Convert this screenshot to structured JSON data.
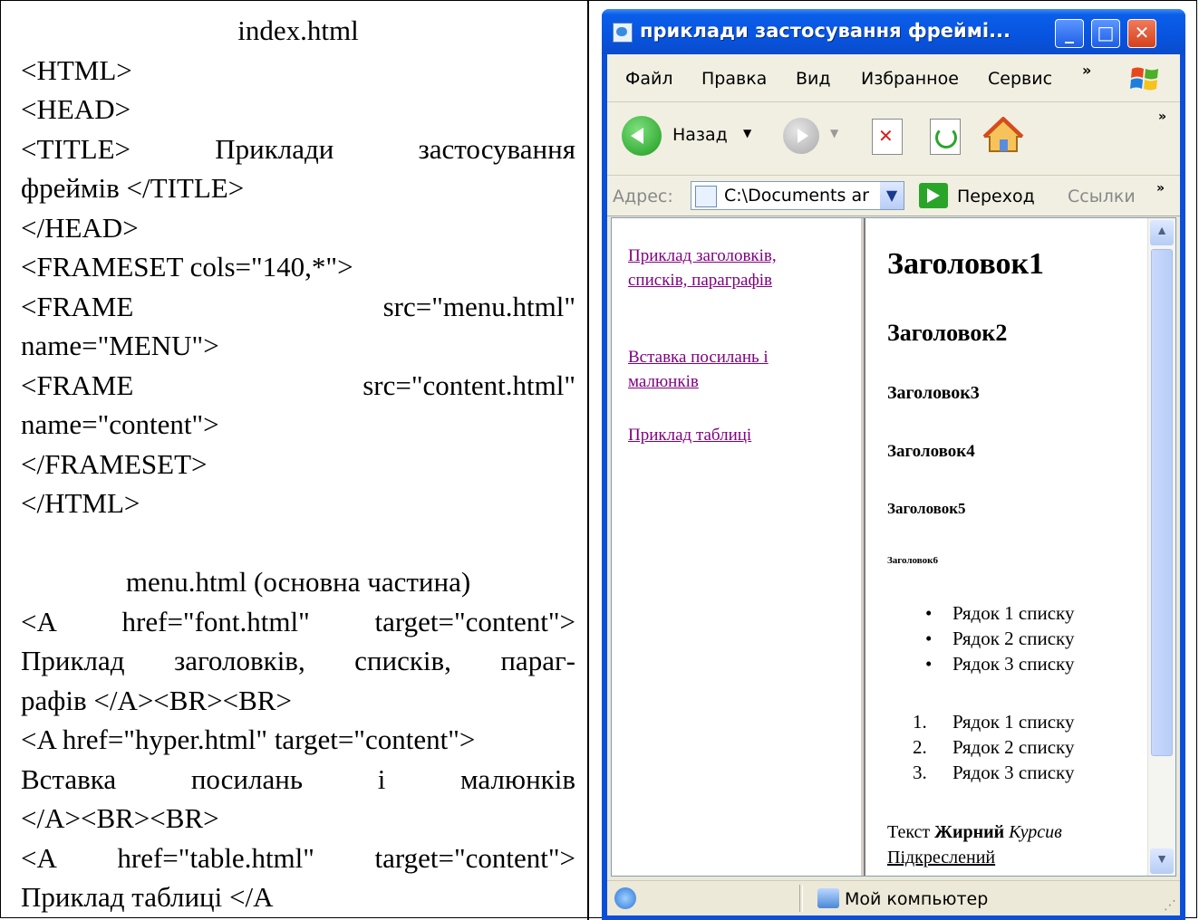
{
  "code_panel": {
    "index_title": "index.html",
    "index_lines": [
      {
        "type": "plain",
        "text": "<HTML>"
      },
      {
        "type": "plain",
        "text": "<HEAD>"
      },
      {
        "type": "just",
        "parts": [
          "<TITLE>",
          "Приклади",
          "застосування"
        ]
      },
      {
        "type": "plain",
        "text": "фреймів </TITLE>"
      },
      {
        "type": "plain",
        "text": "</HEAD>"
      },
      {
        "type": "plain",
        "text": "<FRAMESET cols=\"140,*\">"
      },
      {
        "type": "just",
        "parts": [
          "<FRAME",
          "src=\"menu.html\""
        ]
      },
      {
        "type": "plain",
        "text": "name=\"MENU\">"
      },
      {
        "type": "just",
        "parts": [
          "<FRAME",
          "src=\"content.html\""
        ]
      },
      {
        "type": "plain",
        "text": "name=\"content\">"
      },
      {
        "type": "plain",
        "text": "</FRAMESET>"
      },
      {
        "type": "plain",
        "text": "</HTML>"
      }
    ],
    "menu_title": "menu.html (основна частина)",
    "menu_lines": [
      {
        "type": "just",
        "parts": [
          "<A",
          "href=\"font.html\"",
          "target=\"content\">"
        ]
      },
      {
        "type": "just",
        "parts": [
          "Приклад",
          "заголовків,",
          "списків,",
          "параг-"
        ]
      },
      {
        "type": "plain",
        "text": "рафів </A><BR><BR>"
      },
      {
        "type": "plain",
        "text": "<A href=\"hyper.html\" target=\"content\">"
      },
      {
        "type": "just",
        "parts": [
          "Вставка",
          "посилань",
          "і",
          "малюнків"
        ]
      },
      {
        "type": "plain",
        "text": "</A><BR><BR>"
      },
      {
        "type": "just",
        "parts": [
          "<A",
          "href=\"table.html\"",
          "target=\"content\">"
        ]
      },
      {
        "type": "plain",
        "text": "Приклад таблиці </A"
      }
    ]
  },
  "window": {
    "title": "приклади застосування фреймі...",
    "minimize_label": "_",
    "maximize_label": "□",
    "close_label": "✕",
    "menu": [
      "Файл",
      "Правка",
      "Вид",
      "Избранное",
      "Сервис"
    ],
    "menu_more": "»",
    "toolbar": {
      "back_label": "Назад",
      "back_drop": "▼",
      "fwd_drop": "▼",
      "more": "»"
    },
    "address": {
      "label": "Адрес:",
      "value": "C:\\Documents ar",
      "dropdown": "▼",
      "go_label": "Переход",
      "links_label": "Ссылки",
      "more": "»"
    },
    "left_frame_links": [
      "Приклад заголовків, списків, параграфів",
      "Вставка посилань і малюнків",
      "Приклад таблиці"
    ],
    "content": {
      "h1": "Заголовок1",
      "h2": "Заголовок2",
      "h3": "Заголовок3",
      "h4": "Заголовок4",
      "h5": "Заголовок5",
      "h6": "Заголовок6",
      "bullet_marker": "•",
      "ul_items": [
        "Рядок 1 списку",
        "Рядок 2 списку",
        "Рядок 3 списку"
      ],
      "ol_numbers": [
        "1.",
        "2.",
        "3."
      ],
      "ol_items": [
        "Рядок 1 списку",
        "Рядок 2 списку",
        "Рядок 3 списку"
      ],
      "para_text": "Текст",
      "para_bold": "Жирний",
      "para_italic": "Курсив",
      "para_underline": "Підкреслений"
    },
    "scroll_up": "▲",
    "scroll_down": "▼",
    "status": {
      "zone": "Мой компьютер",
      "grip": "⋰"
    }
  }
}
